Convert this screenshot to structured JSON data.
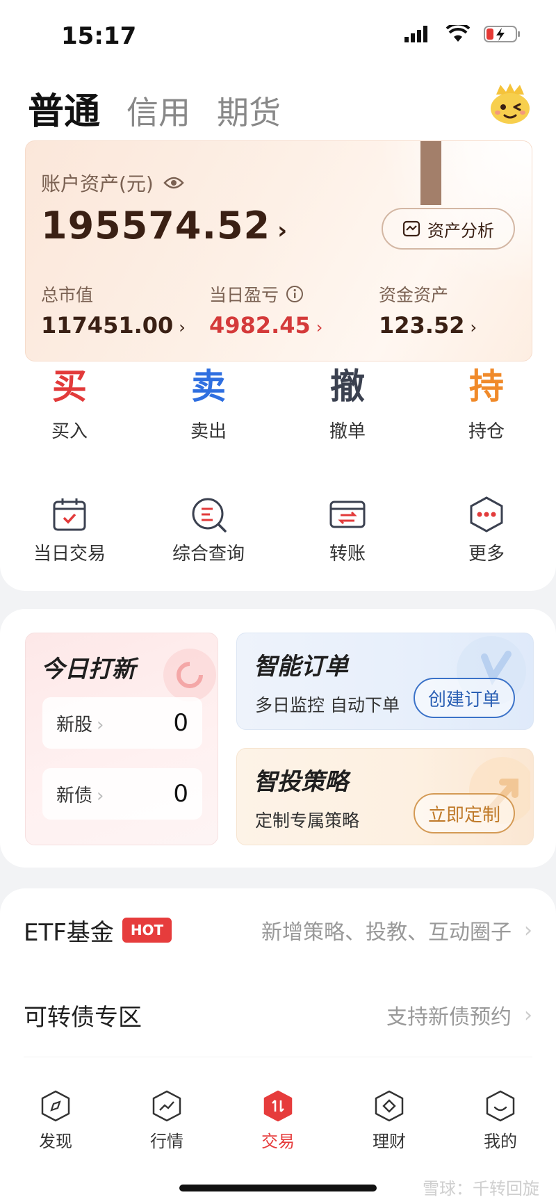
{
  "status": {
    "time": "15:17"
  },
  "tabs": [
    {
      "label": "普通",
      "active": true
    },
    {
      "label": "信用",
      "active": false
    },
    {
      "label": "期货",
      "active": false
    }
  ],
  "asset": {
    "title": "账户资产(元)",
    "total": "195574.52",
    "analyze_label": "资产分析",
    "stats": [
      {
        "label": "总市值",
        "value": "117451.00"
      },
      {
        "label": "当日盈亏",
        "value": "4982.45"
      },
      {
        "label": "资金资产",
        "value": "123.52"
      }
    ]
  },
  "quick_actions": [
    {
      "glyph": "买",
      "label": "买入",
      "color": "#e23a3a"
    },
    {
      "glyph": "卖",
      "label": "卖出",
      "color": "#2f6fe0"
    },
    {
      "glyph": "撤",
      "label": "撤单",
      "color": "#3b4150"
    },
    {
      "glyph": "持",
      "label": "持仓",
      "color": "#f08a2a"
    }
  ],
  "tools": [
    {
      "label": "当日交易",
      "icon": "calendar-check-icon"
    },
    {
      "label": "综合查询",
      "icon": "search-doc-icon"
    },
    {
      "label": "转账",
      "icon": "transfer-icon"
    },
    {
      "label": "更多",
      "icon": "more-icon"
    }
  ],
  "ipo": {
    "title": "今日打新",
    "rows": [
      {
        "label": "新股",
        "count": "0"
      },
      {
        "label": "新债",
        "count": "0"
      }
    ]
  },
  "smart_order": {
    "title": "智能订单",
    "subtitle": "多日监控 自动下单",
    "button": "创建订单"
  },
  "strategy": {
    "title": "智投策略",
    "subtitle": "定制专属策略",
    "button": "立即定制"
  },
  "list": [
    {
      "title": "ETF基金",
      "badge": "HOT",
      "right": "新增策略、投教、互动圈子"
    },
    {
      "title": "可转债专区",
      "badge": "",
      "right": "支持新债预约"
    }
  ],
  "nav": [
    {
      "label": "发现",
      "icon": "compass-icon",
      "active": false
    },
    {
      "label": "行情",
      "icon": "chart-icon",
      "active": false
    },
    {
      "label": "交易",
      "icon": "trade-icon",
      "active": true
    },
    {
      "label": "理财",
      "icon": "wealth-icon",
      "active": false
    },
    {
      "label": "我的",
      "icon": "profile-icon",
      "active": false
    }
  ],
  "watermark": "雪球：千转回旋",
  "colors": {
    "accent_red": "#e63c3c",
    "asset_brown": "#3a2014",
    "profit_red": "#d43a3a"
  }
}
